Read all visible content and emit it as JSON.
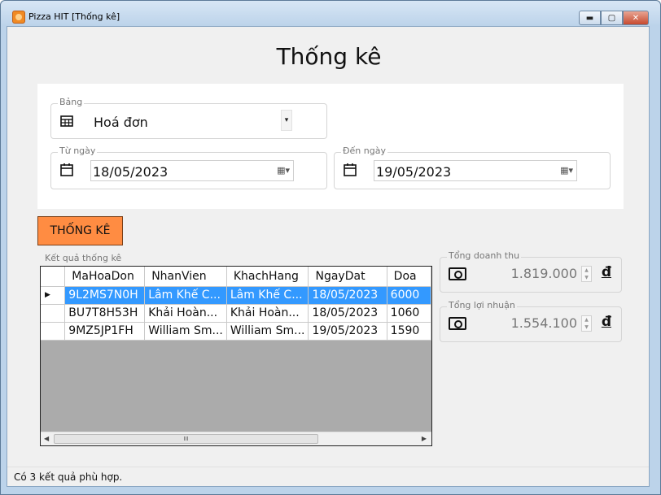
{
  "window": {
    "title": "Pizza HIT [Thống kê]",
    "minimize_glyph": "▬",
    "maximize_glyph": "▢",
    "close_glyph": "✕"
  },
  "page": {
    "title": "Thống kê"
  },
  "filters": {
    "table_group_label": "Bảng",
    "table_value": "Hoá đơn",
    "table_icon": "table-grid-icon",
    "from_label": "Từ ngày",
    "from_value": "18/05/2023",
    "to_label": "Đến ngày",
    "to_value": "19/05/2023",
    "calendar_icon": "calendar-icon"
  },
  "actions": {
    "stat_button": "THỐNG KÊ"
  },
  "results": {
    "label": "Kết quả thống kê",
    "columns": [
      "MaHoaDon",
      "NhanVien",
      "KhachHang",
      "NgayDat",
      "Doa"
    ],
    "rows": [
      [
        "9L2MS7N0H",
        "Lâm Khế C...",
        "Lâm Khế C...",
        "18/05/2023",
        "6000"
      ],
      [
        "BU7T8H53H",
        "Khải Hoàn...",
        "Khải Hoàn...",
        "18/05/2023",
        "1060"
      ],
      [
        "9MZ5JP1FH",
        "William Sm...",
        "William Sm...",
        "19/05/2023",
        "1590"
      ]
    ],
    "selected_row": 0,
    "row_indicator": "▶",
    "scroll_left": "◀",
    "scroll_right": "▶",
    "scroll_thumb_grip": "III"
  },
  "summary": {
    "revenue_label": "Tổng doanh thu",
    "revenue_value": "1.819.000",
    "profit_label": "Tổng lợi nhuận",
    "profit_value": "1.554.100",
    "currency_symbol": "đ",
    "money_icon": "money-icon"
  },
  "status": {
    "text": "Có 3 kết quả phù hợp."
  },
  "colors": {
    "accent_button": "#ff8c42",
    "selection": "#3399ff",
    "grid_background": "#ababab"
  }
}
